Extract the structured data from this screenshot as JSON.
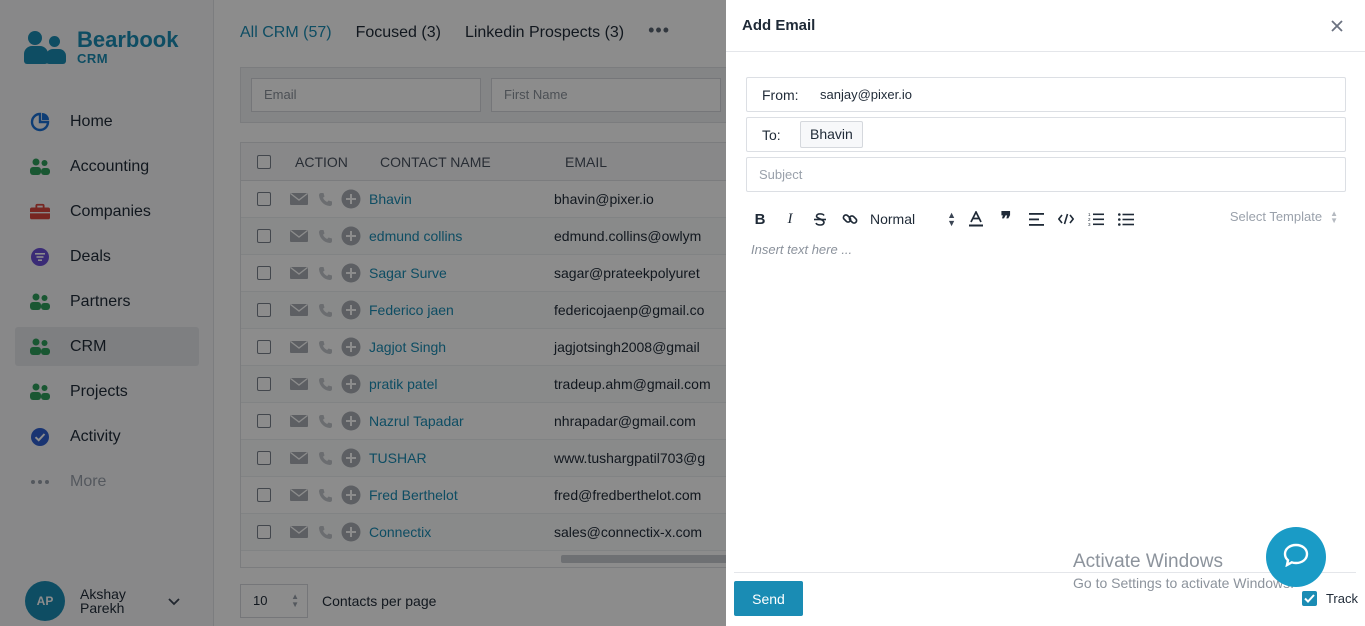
{
  "brand": {
    "name": "Bearbook",
    "sub": "CRM",
    "color": "#1a8cb4"
  },
  "nav": [
    {
      "label": "Home",
      "icon": "pie-chart-icon"
    },
    {
      "label": "Accounting",
      "icon": "users-icon"
    },
    {
      "label": "Companies",
      "icon": "briefcase-icon"
    },
    {
      "label": "Deals",
      "icon": "filter-icon"
    },
    {
      "label": "Partners",
      "icon": "users-icon"
    },
    {
      "label": "CRM",
      "icon": "users-icon",
      "active": true
    },
    {
      "label": "Projects",
      "icon": "users-icon"
    },
    {
      "label": "Activity",
      "icon": "check-circle-icon"
    },
    {
      "label": "More",
      "icon": "dots-icon"
    }
  ],
  "user": {
    "initials": "AP",
    "name": "Akshay Parekh"
  },
  "tabs": [
    "All CRM (57)",
    "Focused (3)",
    "Linkedin Prospects (3)"
  ],
  "tabs_more": "•••",
  "filters": {
    "email_placeholder": "Email",
    "first_name_placeholder": "First Name"
  },
  "table": {
    "headers": {
      "action": "ACTION",
      "contact_name": "CONTACT NAME",
      "email": "EMAIL"
    },
    "rows": [
      {
        "name": "Bhavin",
        "email": "bhavin@pixer.io"
      },
      {
        "name": "edmund collins",
        "email": "edmund.collins@owlym"
      },
      {
        "name": "Sagar Surve",
        "email": "sagar@prateekpolyuret"
      },
      {
        "name": "Federico jaen",
        "email": "federicojaenp@gmail.co"
      },
      {
        "name": "Jagjot Singh",
        "email": "jagjotsingh2008@gmail"
      },
      {
        "name": "pratik patel",
        "email": "tradeup.ahm@gmail.com"
      },
      {
        "name": "Nazrul Tapadar",
        "email": "nhrapadar@gmail.com"
      },
      {
        "name": "TUSHAR",
        "email": "www.tushargpatil703@g"
      },
      {
        "name": "Fred Berthelot",
        "email": "fred@fredberthelot.com"
      },
      {
        "name": "Connectix",
        "email": "sales@connectix-x.com"
      }
    ]
  },
  "pager": {
    "per_page": "10",
    "label": "Contacts per page"
  },
  "modal": {
    "title": "Add Email",
    "from_label": "From:",
    "from_value": "sanjay@pixer.io",
    "to_label": "To:",
    "to_chip": "Bhavin",
    "subject_placeholder": "Subject",
    "format_select": "Normal",
    "template_placeholder": "Select Template",
    "editor_placeholder": "Insert text here ...",
    "send_label": "Send",
    "track_label": "Track",
    "track_checked": true
  },
  "watermark": {
    "line1": "Activate Windows",
    "line2": "Go to Settings to activate Windows."
  }
}
